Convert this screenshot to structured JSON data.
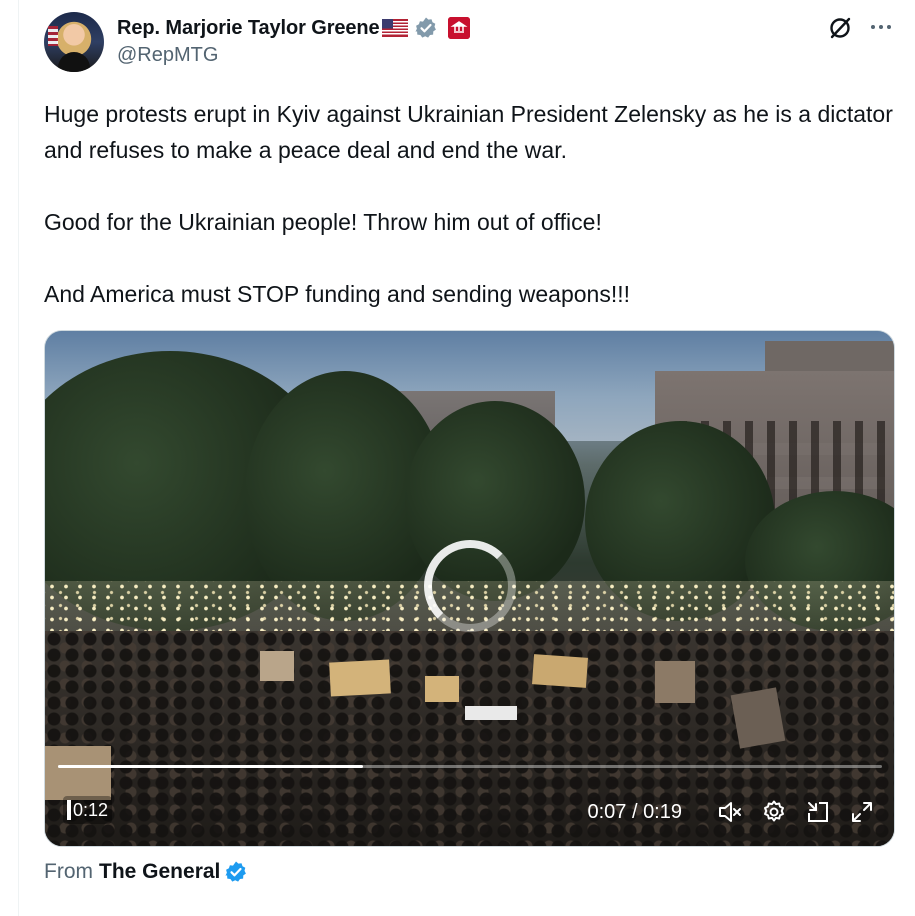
{
  "author": {
    "display_name": "Rep. Marjorie Taylor Greene",
    "flag": "🇺🇸",
    "handle": "@RepMTG",
    "verified_badge": "grey-verified",
    "affiliation_badge": "government-affiliation"
  },
  "header_actions": {
    "grok_icon": "grok-icon",
    "more_icon": "more-icon"
  },
  "tweet": {
    "paragraphs": [
      "Huge protests erupt in Kyiv against Ukrainian President Zelensky as he is a dictator and refuses to make a peace deal and end the war.",
      "Good for the Ukrainian people! Throw him out of office!",
      "And America must STOP funding and sending weapons!!!"
    ]
  },
  "video": {
    "thumbnail_time": "0:12",
    "current_time": "0:07",
    "separator": " / ",
    "duration": "0:19",
    "progress_fraction": 0.37,
    "controls": [
      "mute-icon",
      "settings-icon",
      "pip-icon",
      "fullscreen-icon"
    ]
  },
  "source": {
    "prefix": "From",
    "name": "The General",
    "badge": "blue-verified"
  },
  "colors": {
    "text_primary": "#0f1419",
    "text_secondary": "#536471",
    "verified_blue": "#1d9bf0",
    "verified_grey": "#829aab"
  }
}
